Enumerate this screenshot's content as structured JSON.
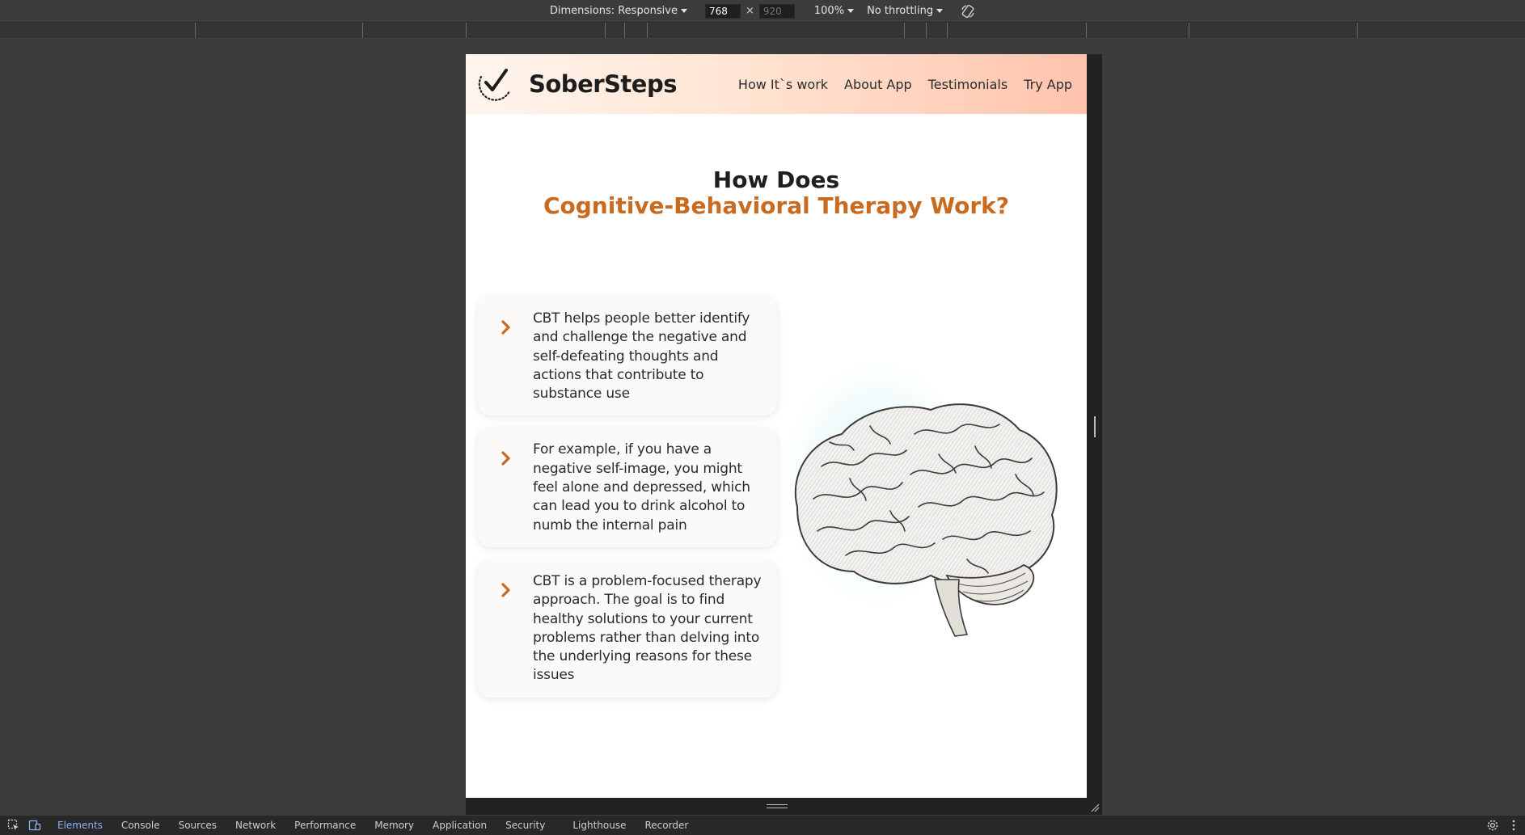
{
  "devtools_toolbar": {
    "dimensions_label": "Dimensions: Responsive",
    "width_value": "768",
    "times": "×",
    "height_placeholder": "920",
    "zoom": "100%",
    "throttling": "No throttling",
    "rotate_icon": "rotate-icon"
  },
  "site": {
    "brand": "SoberSteps",
    "nav": [
      "How It`s work",
      "About App",
      "Testimonials",
      "Try App"
    ],
    "title_line1": "How Does",
    "title_line2": "Cognitive-Behavioral Therapy Work?",
    "cards": [
      "CBT helps people better identify and challenge the negative and self-defeating thoughts and actions that contribute to substance use",
      "For example, if you have a negative self-image, you might feel alone and depressed, which can lead you to drink alcohol to numb the internal pain",
      "CBT is a problem-focused therapy approach. The goal is to find healthy solutions to your current problems rather than delving into the underlying reasons for these issues"
    ],
    "colors": {
      "accent": "#c96a1f",
      "header_start": "#fff5ee",
      "header_end": "#ffc3ad"
    }
  },
  "devtools_tabs": {
    "items": [
      "Elements",
      "Console",
      "Sources",
      "Network",
      "Performance",
      "Memory",
      "Application",
      "Security",
      "Lighthouse",
      "Recorder"
    ],
    "active": "Elements"
  }
}
